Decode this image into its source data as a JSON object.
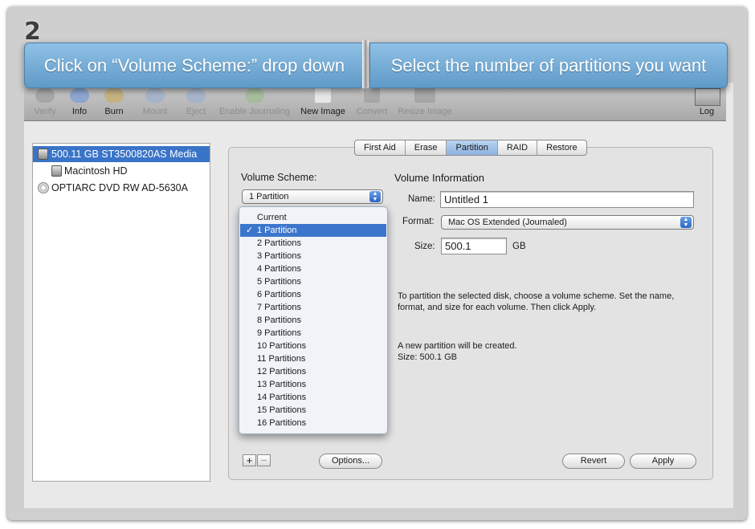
{
  "step_number": "2",
  "banners": {
    "left": "Click on “Volume Scheme:” drop down",
    "right": "Select the number of partitions you want"
  },
  "toolbar": {
    "items": [
      {
        "label": "Verify",
        "icon": "microscope-icon",
        "enabled": false
      },
      {
        "label": "Info",
        "icon": "info-icon",
        "enabled": true
      },
      {
        "label": "Burn",
        "icon": "burn-icon",
        "enabled": true
      },
      {
        "label": "Mount",
        "icon": "mount-icon",
        "enabled": false
      },
      {
        "label": "Eject",
        "icon": "eject-icon",
        "enabled": false
      },
      {
        "label": "Enable Journaling",
        "icon": "journaling-icon",
        "enabled": false
      },
      {
        "label": "New Image",
        "icon": "new-image-icon",
        "enabled": true
      },
      {
        "label": "Convert",
        "icon": "convert-icon",
        "enabled": false
      },
      {
        "label": "Resize Image",
        "icon": "resize-image-icon",
        "enabled": false
      },
      {
        "label": "Log",
        "icon": "log-icon",
        "enabled": true
      }
    ]
  },
  "sidebar": {
    "items": [
      {
        "label": "500.11 GB ST3500820AS Media",
        "icon": "hard-disk-icon",
        "selected": true
      },
      {
        "label": "Macintosh HD",
        "icon": "volume-icon",
        "selected": false
      },
      {
        "label": "OPTIARC DVD RW AD-5630A",
        "icon": "dvd-drive-icon",
        "selected": false
      }
    ]
  },
  "tabs": {
    "items": [
      "First Aid",
      "Erase",
      "Partition",
      "RAID",
      "Restore"
    ],
    "active": "Partition"
  },
  "volume_scheme": {
    "label": "Volume Scheme:",
    "selected": "1 Partition",
    "options": [
      "Current",
      "1 Partition",
      "2 Partitions",
      "3 Partitions",
      "4 Partitions",
      "5 Partitions",
      "6 Partitions",
      "7 Partitions",
      "8 Partitions",
      "9 Partitions",
      "10 Partitions",
      "11 Partitions",
      "12 Partitions",
      "13 Partitions",
      "14 Partitions",
      "15 Partitions",
      "16 Partitions"
    ]
  },
  "volume_info": {
    "title": "Volume Information",
    "name_label": "Name:",
    "name_value": "Untitled 1",
    "format_label": "Format:",
    "format_value": "Mac OS Extended (Journaled)",
    "size_label": "Size:",
    "size_value": "500.1",
    "size_unit": "GB"
  },
  "description": {
    "line1": "To partition the selected disk, choose a volume scheme. Set the name,",
    "line2": "format, and size for each volume. Then click Apply.",
    "line3": "A new partition will be created.",
    "line4": "Size: 500.1 GB"
  },
  "buttons": {
    "add": "+",
    "remove": "−",
    "options": "Options...",
    "revert": "Revert",
    "apply": "Apply"
  },
  "colors": {
    "banner": "#6fa6d2",
    "selection": "#3a74c8"
  }
}
